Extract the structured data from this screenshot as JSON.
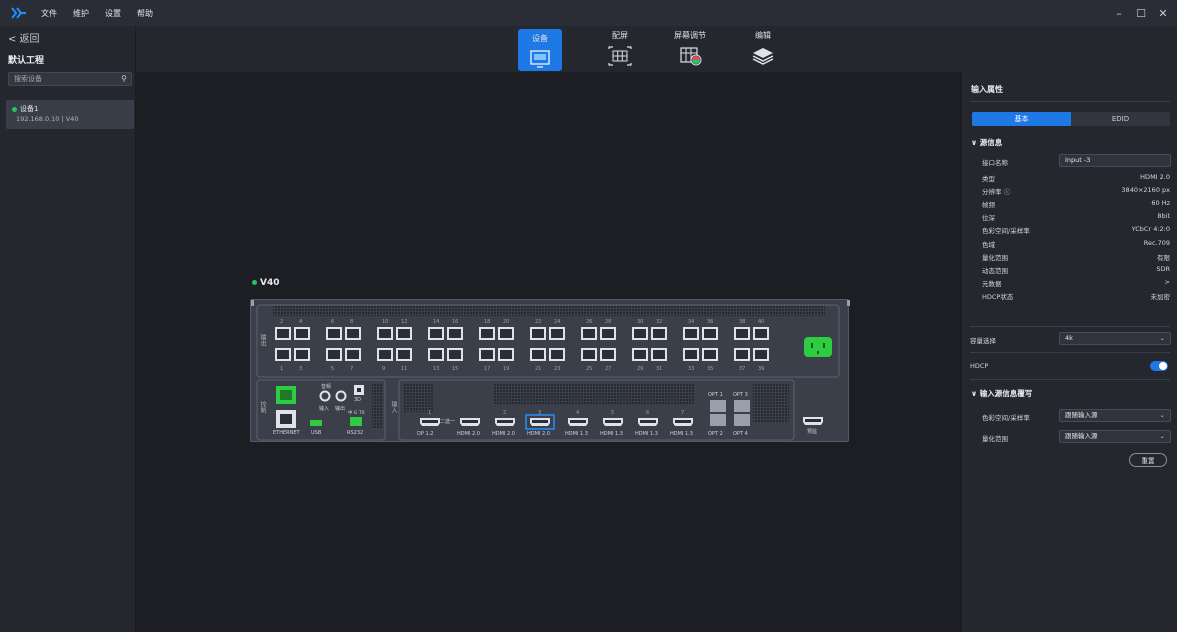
{
  "menu": {
    "items": [
      "文件",
      "维护",
      "设置",
      "帮助"
    ]
  },
  "window": {
    "minimize": "–",
    "maximize": "☐",
    "close": "✕"
  },
  "sidebar": {
    "back_label": "< 返回",
    "project_title": "默认工程",
    "search_placeholder": "搜索设备",
    "devices": [
      {
        "name": "设备1",
        "subtitle": "192.168.0.10 | V40",
        "status": "online"
      }
    ]
  },
  "toolbar": {
    "tabs": [
      {
        "label": "设备",
        "active": true
      },
      {
        "label": "配屏",
        "active": false
      },
      {
        "label": "屏幕调节",
        "active": false
      },
      {
        "label": "编辑",
        "active": false
      }
    ]
  },
  "canvas": {
    "device_label": "V40",
    "device": {
      "side_labels": {
        "output": "输出",
        "control": "控制",
        "input": "输入"
      },
      "output_numbers_top": [
        "2",
        "4",
        "6",
        "8",
        "10",
        "12",
        "14",
        "16",
        "18",
        "20",
        "22",
        "24",
        "26",
        "28",
        "30",
        "32",
        "34",
        "36",
        "38",
        "40"
      ],
      "output_numbers_bottom": [
        "1",
        "3",
        "5",
        "7",
        "9",
        "11",
        "13",
        "15",
        "17",
        "19",
        "21",
        "23",
        "25",
        "27",
        "29",
        "31",
        "33",
        "35",
        "37",
        "39"
      ],
      "control_labels": {
        "ethernet": "ETHERNET",
        "usb": "USB",
        "rs232": "RS232",
        "audio": "音频",
        "audio_in": "输入",
        "audio_out": "输出",
        "three_d": "3D",
        "pin_labels": "中 G TX"
      },
      "input_ports": [
        {
          "num": "1",
          "label": "DP 1.2"
        },
        {
          "num": "",
          "label": "HDMI 2.0"
        },
        {
          "num": "2",
          "label": "HDMI 2.0"
        },
        {
          "num": "3",
          "label": "HDMI 2.0"
        },
        {
          "num": "4",
          "label": "HDMI 1.3"
        },
        {
          "num": "5",
          "label": "HDMI 1.3"
        },
        {
          "num": "6",
          "label": "HDMI 1.3"
        },
        {
          "num": "7",
          "label": "HDMI 1.3"
        }
      ],
      "bracket_label": "二选一",
      "opt_labels": {
        "opt1": "OPT 1",
        "opt3": "OPT 3",
        "opt2": "OPT 2",
        "opt4": "OPT 4"
      },
      "monitor_label": "预监"
    }
  },
  "props": {
    "title": "输入属性",
    "tab_basic": "基本",
    "tab_edid": "EDID",
    "source_section": "源信息",
    "interface_name_label": "接口名称",
    "interface_name_value": "Input -3",
    "rows": [
      {
        "k": "类型",
        "v": "HDMI 2.0"
      },
      {
        "k": "分辨率 ⓘ",
        "v": "3840×2160 px"
      },
      {
        "k": "帧频",
        "v": "60 Hz"
      },
      {
        "k": "位深",
        "v": "8bit"
      },
      {
        "k": "色彩空间/采样率",
        "v": "YCbCr 4:2:0"
      },
      {
        "k": "色域",
        "v": "Rec.709"
      },
      {
        "k": "量化范围",
        "v": "有限"
      },
      {
        "k": "动态范围",
        "v": "SDR"
      },
      {
        "k": "元数据",
        "v": ">"
      },
      {
        "k": "HDCP状态",
        "v": "未加密"
      }
    ],
    "capacity_label": "容量选择",
    "capacity_value": "4k",
    "hdcp_label": "HDCP",
    "hdcp_on": true,
    "rewrite_section": "输入源信息覆写",
    "color_space_label": "色彩空间/采样率",
    "color_space_value": "跟随输入源",
    "quant_label": "量化范围",
    "quant_value": "跟随输入源",
    "reset_label": "重置"
  }
}
